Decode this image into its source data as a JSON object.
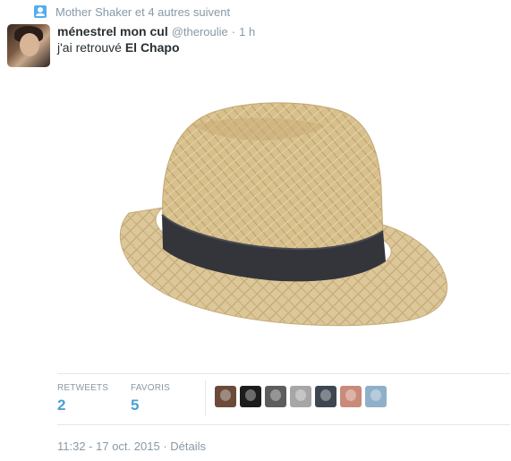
{
  "context": {
    "icon": "person-icon",
    "text": "Mother Shaker et 4 autres suivent"
  },
  "tweet": {
    "fullname": "ménestrel mon cul",
    "username": "@theroulie",
    "separator": "·",
    "time": "1 h",
    "text_prefix": "j'ai retrouvé ",
    "text_bold": "El Chapo"
  },
  "stats": {
    "retweets_label": "RETWEETS",
    "retweets_count": "2",
    "favorites_label": "FAVORIS",
    "favorites_count": "5"
  },
  "favoriters": [
    {
      "name": "favoriter-avatar-1",
      "color": "#6b4a3a"
    },
    {
      "name": "favoriter-avatar-2",
      "color": "#1c1c1c"
    },
    {
      "name": "favoriter-avatar-3",
      "color": "#5d5d5d"
    },
    {
      "name": "favoriter-avatar-4",
      "color": "#a6a6a6"
    },
    {
      "name": "favoriter-avatar-5",
      "color": "#3e4750"
    },
    {
      "name": "favoriter-avatar-6",
      "color": "#c98a7a"
    },
    {
      "name": "favoriter-avatar-7",
      "color": "#8fb0c8"
    }
  ],
  "footer": {
    "datetime": "11:32 - 17 oct. 2015",
    "separator": "·",
    "details": "Détails"
  },
  "colors": {
    "accent": "#4c9fd5",
    "muted": "#8899a6",
    "text": "#292f33"
  }
}
